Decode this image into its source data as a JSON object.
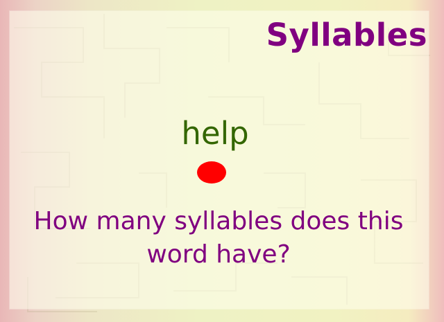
{
  "slide": {
    "title": "Syllables",
    "word": "help",
    "question": "How many syllables does this word have?",
    "click_marker_icon": "red-dot"
  },
  "colors": {
    "title": "#800080",
    "word": "#336600",
    "question": "#800080",
    "marker": "#ff0000"
  }
}
